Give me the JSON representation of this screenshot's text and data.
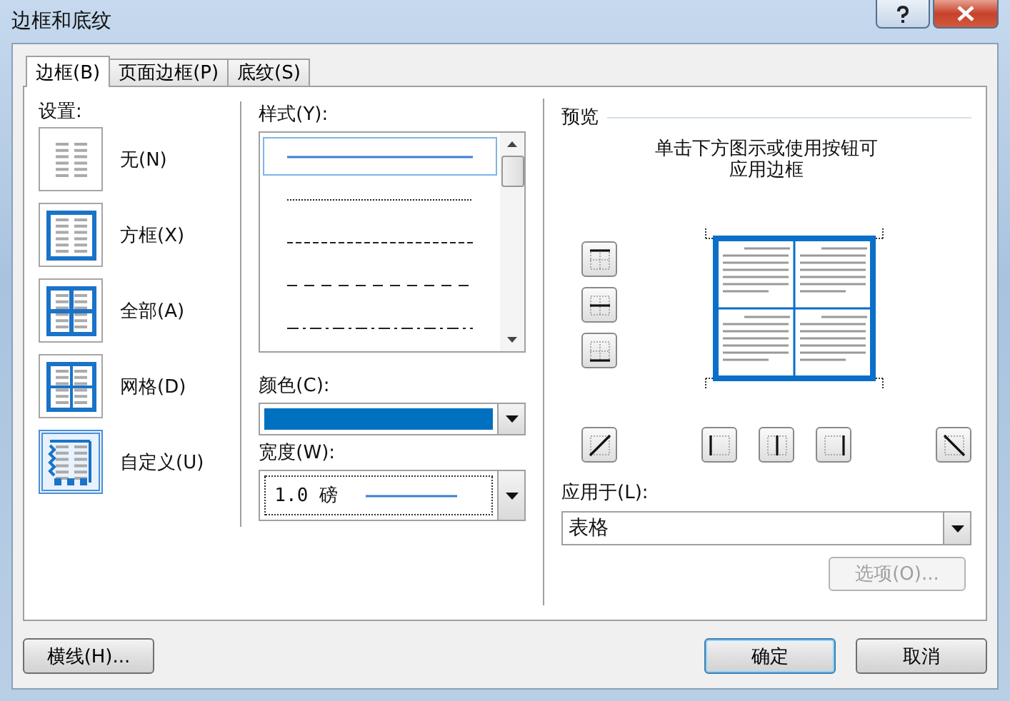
{
  "window": {
    "title": "边框和底纹"
  },
  "tabs": [
    {
      "label": "边框(B)",
      "selected": true
    },
    {
      "label": "页面边框(P)",
      "selected": false
    },
    {
      "label": "底纹(S)",
      "selected": false
    }
  ],
  "settings": {
    "label": "设置:",
    "items": [
      {
        "kind": "none",
        "label": "无(N)",
        "selected": false
      },
      {
        "kind": "box",
        "label": "方框(X)",
        "selected": false
      },
      {
        "kind": "all",
        "label": "全部(A)",
        "selected": false
      },
      {
        "kind": "grid",
        "label": "网格(D)",
        "selected": false
      },
      {
        "kind": "custom",
        "label": "自定义(U)",
        "selected": true
      }
    ]
  },
  "style": {
    "label": "样式(Y):",
    "lines": [
      {
        "kind": "solid",
        "selected": true
      },
      {
        "kind": "dotted",
        "selected": false
      },
      {
        "kind": "dashed",
        "selected": false
      },
      {
        "kind": "long-dash",
        "selected": false
      },
      {
        "kind": "dash-dot",
        "selected": false
      }
    ]
  },
  "color": {
    "label": "颜色(C):",
    "color": "#0070c0"
  },
  "width": {
    "label": "宽度(W):",
    "value": "1.0 磅"
  },
  "preview": {
    "title": "预览",
    "hint_lines": [
      "单击下方图示或使用按钮可",
      "应用边框"
    ]
  },
  "apply_to": {
    "label": "应用于(L):",
    "value": "表格"
  },
  "options_button": {
    "label": "选项(O)...",
    "disabled": true
  },
  "horizontal_line_button": {
    "label": "横线(H)..."
  },
  "ok_button": {
    "label": "确定"
  },
  "cancel_button": {
    "label": "取消"
  }
}
